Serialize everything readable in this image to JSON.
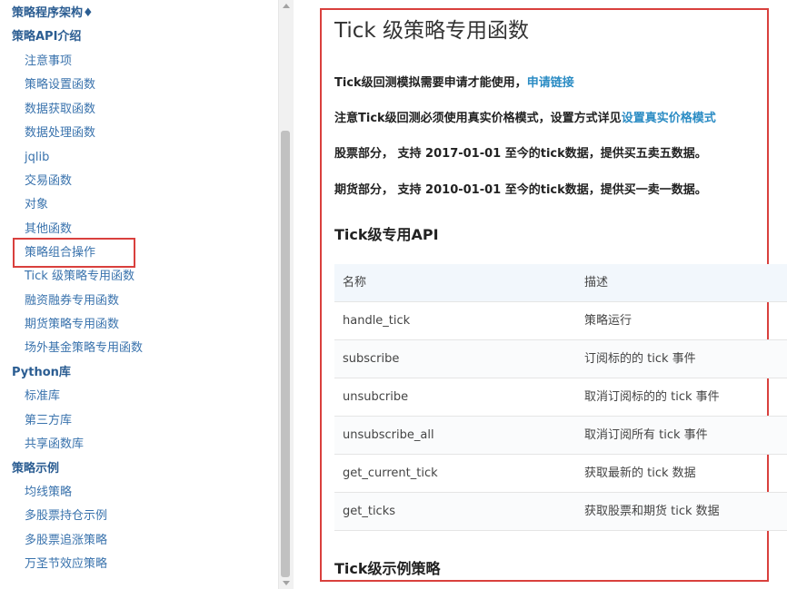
{
  "sidebar": {
    "items": [
      {
        "label": "策略程序架构♦",
        "type": "section"
      },
      {
        "label": "策略API介绍",
        "type": "section"
      },
      {
        "label": "注意事项",
        "type": "sub"
      },
      {
        "label": "策略设置函数",
        "type": "sub"
      },
      {
        "label": "数据获取函数",
        "type": "sub"
      },
      {
        "label": "数据处理函数",
        "type": "sub"
      },
      {
        "label": "jqlib",
        "type": "sub"
      },
      {
        "label": "交易函数",
        "type": "sub"
      },
      {
        "label": "对象",
        "type": "sub"
      },
      {
        "label": "其他函数",
        "type": "sub"
      },
      {
        "label": "策略组合操作",
        "type": "sub",
        "highlighted": true
      },
      {
        "label": "Tick 级策略专用函数",
        "type": "sub"
      },
      {
        "label": "融资融券专用函数",
        "type": "sub"
      },
      {
        "label": "期货策略专用函数",
        "type": "sub"
      },
      {
        "label": "场外基金策略专用函数",
        "type": "sub"
      },
      {
        "label": "Python库",
        "type": "section"
      },
      {
        "label": "标准库",
        "type": "sub"
      },
      {
        "label": "第三方库",
        "type": "sub"
      },
      {
        "label": "共享函数库",
        "type": "sub"
      },
      {
        "label": "策略示例",
        "type": "section"
      },
      {
        "label": "均线策略",
        "type": "sub"
      },
      {
        "label": "多股票持仓示例",
        "type": "sub"
      },
      {
        "label": "多股票追涨策略",
        "type": "sub"
      },
      {
        "label": "万圣节效应策略",
        "type": "sub"
      }
    ]
  },
  "main": {
    "title": "Tick 级策略专用函数",
    "p1_text": "Tick级回测模拟需要申请才能使用，",
    "p1_link": "申请链接",
    "p2_text": "注意Tick级回测必须使用真实价格模式，设置方式详见",
    "p2_link": "设置真实价格模式",
    "p3_text": "股票部分， 支持 2017-01-01 至今的tick数据，提供买五卖五数据。",
    "p4_text": "期货部分， 支持 2010-01-01 至今的tick数据，提供买一卖一数据。",
    "api_heading": "Tick级专用API",
    "table": {
      "headers": [
        "名称",
        "描述"
      ],
      "rows": [
        [
          "handle_tick",
          "策略运行"
        ],
        [
          "subscribe",
          "订阅标的的 tick 事件"
        ],
        [
          "unsubcribe",
          "取消订阅标的的 tick 事件"
        ],
        [
          "unsubscribe_all",
          "取消订阅所有 tick 事件"
        ],
        [
          "get_current_tick",
          "获取最新的 tick 数据"
        ],
        [
          "get_ticks",
          "获取股票和期货 tick 数据"
        ]
      ]
    },
    "example_heading": "Tick级示例策略"
  },
  "colors": {
    "link": "#2b8cc4",
    "nav": "#3a73ad",
    "highlight_border": "#d9403d",
    "table_header_bg": "#f2f7fc"
  }
}
